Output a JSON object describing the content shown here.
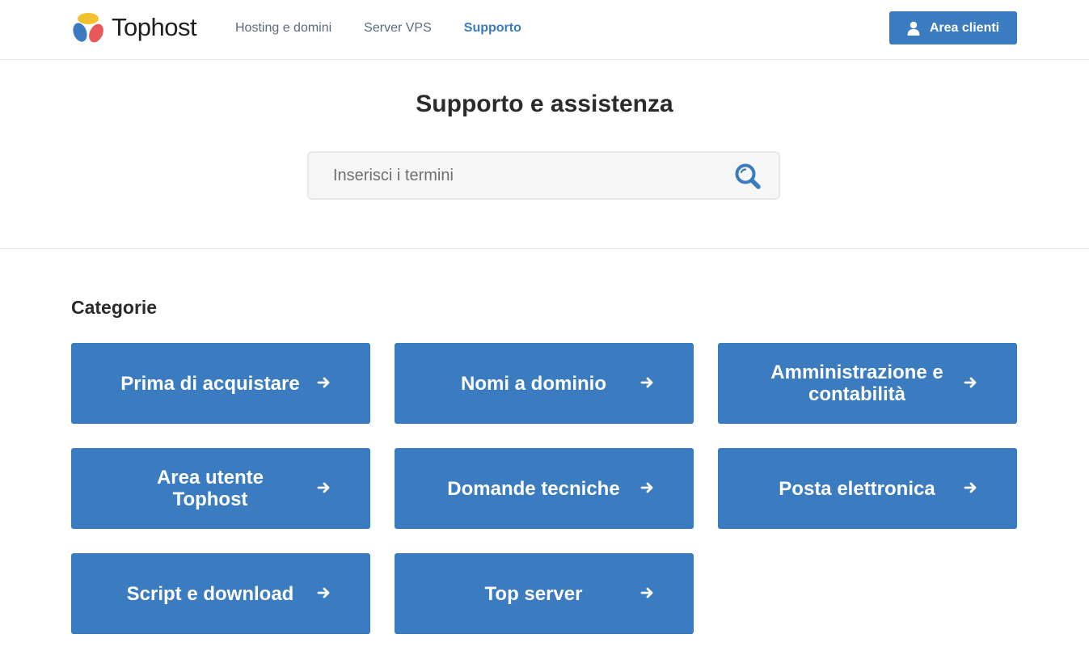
{
  "brand": {
    "name": "Tophost",
    "colors": {
      "yellow": "#f2c12e",
      "blue": "#3b7bbf",
      "red": "#e85a5a"
    }
  },
  "nav": {
    "items": [
      {
        "label": "Hosting e domini",
        "active": false
      },
      {
        "label": "Server VPS",
        "active": false
      },
      {
        "label": "Supporto",
        "active": true
      }
    ]
  },
  "header": {
    "client_button": {
      "label": "Area clienti",
      "icon": "user-icon"
    }
  },
  "hero": {
    "title": "Supporto e assistenza",
    "search": {
      "placeholder": "Inserisci i termini",
      "value": "",
      "icon": "search-icon"
    }
  },
  "categories": {
    "title": "Categorie",
    "items": [
      {
        "label": "Prima di acquistare",
        "icon": "arrow-right-icon"
      },
      {
        "label": "Nomi a dominio",
        "icon": "arrow-right-icon"
      },
      {
        "label": "Amministrazione e contabilità",
        "icon": "arrow-right-icon"
      },
      {
        "label": "Area utente Tophost",
        "icon": "arrow-right-icon"
      },
      {
        "label": "Domande tecniche",
        "icon": "arrow-right-icon"
      },
      {
        "label": "Posta elettronica",
        "icon": "arrow-right-icon"
      },
      {
        "label": "Script e download",
        "icon": "arrow-right-icon"
      },
      {
        "label": "Top server",
        "icon": "arrow-right-icon"
      }
    ]
  },
  "theme": {
    "accent": "#3b7bbf",
    "text": "#2b2b2b",
    "nav_text": "#5a6b80",
    "divider": "#e8e8e8"
  }
}
